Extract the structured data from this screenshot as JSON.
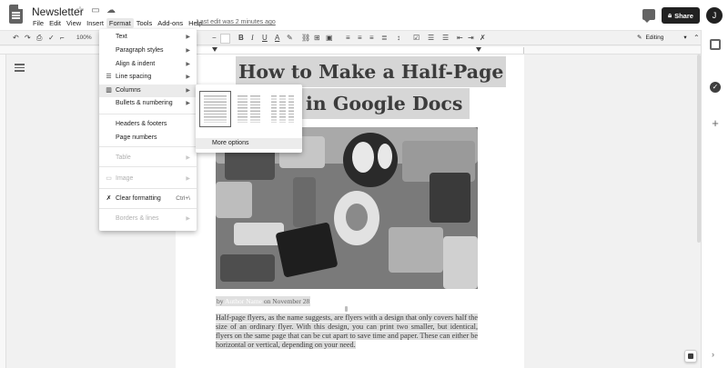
{
  "app": {
    "doc_title": "Newsletter",
    "last_edit": "Last edit was 2 minutes ago",
    "menu": [
      "File",
      "Edit",
      "View",
      "Insert",
      "Format",
      "Tools",
      "Add-ons",
      "Help"
    ],
    "share_label": "Share",
    "avatar_initial": "J"
  },
  "toolbar": {
    "zoom": "100%",
    "font_size_minus": "−",
    "bold": "B",
    "italic": "I",
    "underline": "U",
    "text_color": "A",
    "mode": "Editing"
  },
  "format_menu": {
    "items": [
      {
        "label": "Text",
        "icon": "",
        "submenu": true,
        "disabled": false
      },
      {
        "label": "Paragraph styles",
        "icon": "",
        "submenu": true,
        "disabled": false
      },
      {
        "label": "Align & indent",
        "icon": "",
        "submenu": true,
        "disabled": false
      },
      {
        "label": "Line spacing",
        "icon": "line-spacing-icon",
        "submenu": true,
        "disabled": false
      },
      {
        "label": "Columns",
        "icon": "columns-icon",
        "submenu": true,
        "disabled": false,
        "highlighted": true
      },
      {
        "label": "Bullets & numbering",
        "icon": "",
        "submenu": true,
        "disabled": false
      },
      {
        "label": "Headers & footers",
        "icon": "",
        "submenu": false,
        "disabled": false
      },
      {
        "label": "Page numbers",
        "icon": "",
        "submenu": false,
        "disabled": false
      },
      {
        "label": "Table",
        "icon": "",
        "submenu": true,
        "disabled": true
      },
      {
        "label": "Image",
        "icon": "image-icon",
        "submenu": true,
        "disabled": true
      },
      {
        "label": "Clear formatting",
        "icon": "clear-formatting-icon",
        "shortcut": "Ctrl+\\",
        "disabled": false
      },
      {
        "label": "Borders & lines",
        "icon": "",
        "submenu": true,
        "disabled": true
      }
    ]
  },
  "columns_menu": {
    "presets": [
      "one-column",
      "two-columns",
      "three-columns"
    ],
    "selected": "one-column",
    "more_options": "More options"
  },
  "document": {
    "heading_line1": "How to Make a Half-Page",
    "heading_line2": "in Google Docs",
    "byline_prefix": "by",
    "byline_author": "Author Name",
    "byline_date": "on November 28",
    "body": "Half-page flyers, as the name suggests, are flyers with a design that only covers half the size of an ordinary flyer. With this design, you can print two smaller, but identical, flyers on the same page that can be cut apart to save time and paper. These can either be horizontal or vertical, depending on your need."
  }
}
